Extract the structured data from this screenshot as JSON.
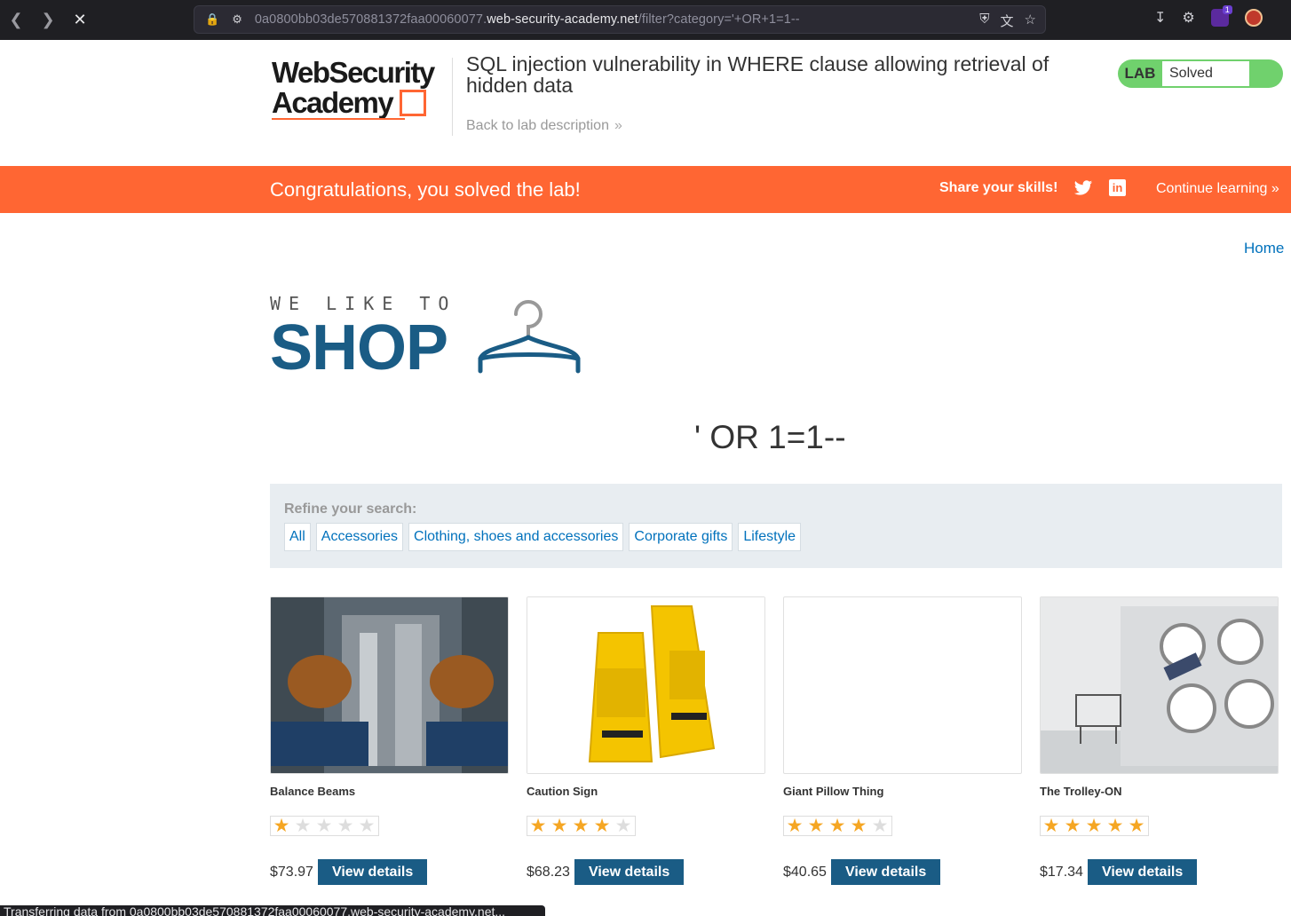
{
  "browser": {
    "url_prefix": "0a0800bb03de570881372faa00060077.",
    "url_host": "web-security-academy.net",
    "url_path": "/filter?category='+OR+1=1--",
    "extension_badge": "1",
    "status_text": "Transferring data from 0a0800bb03de570881372faa00060077.web-security-academy.net..."
  },
  "header": {
    "logo_line1": "WebSecurity",
    "logo_line2": "Academy",
    "lab_title": "SQL injection vulnerability in WHERE clause allowing retrieval of hidden data",
    "back_link": "Back to lab description",
    "badge_label": "LAB",
    "badge_status": "Solved"
  },
  "banner": {
    "message": "Congratulations, you solved the lab!",
    "share_label": "Share your skills!",
    "continue_label": "Continue learning"
  },
  "shop": {
    "home_link": "Home",
    "logo_tagline": "WE LIKE TO",
    "logo_word": "SHOP",
    "search_term": "' OR 1=1--",
    "refine_label": "Refine your search:",
    "filters": [
      "All",
      "Accessories",
      "Clothing, shoes and accessories",
      "Corporate gifts",
      "Lifestyle"
    ],
    "view_label": "View details",
    "products": [
      {
        "name": "Balance Beams",
        "rating": 1,
        "price": "$73.97"
      },
      {
        "name": "Caution Sign",
        "rating": 4,
        "price": "$68.23"
      },
      {
        "name": "Giant Pillow Thing",
        "rating": 4,
        "price": "$40.65"
      },
      {
        "name": "The Trolley-ON",
        "rating": 5,
        "price": "$17.34"
      }
    ]
  },
  "colors": {
    "brand_orange": "#ff6633",
    "shop_blue": "#1a5c85",
    "link_blue": "#0071bc",
    "solved_green": "#70d16d",
    "star_gold": "#f5a623"
  }
}
